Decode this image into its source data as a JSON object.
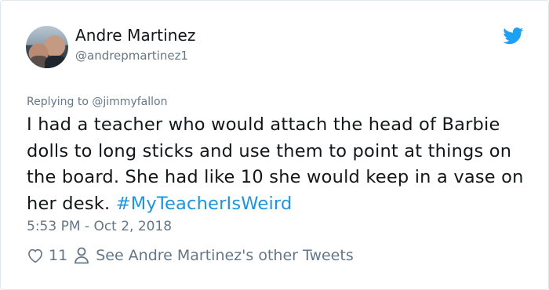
{
  "author": {
    "name": "Andre Martinez",
    "handle": "@andrepmartinez1"
  },
  "reply": {
    "prefix": "Replying to ",
    "mention": "@jimmyfallon"
  },
  "tweet": {
    "text": "I had a teacher who would attach the head of Barbie dolls to long sticks and use them to point at things on the board. She had like 10 she would keep in a vase on her desk. ",
    "hashtag": "#MyTeacherIsWeird",
    "timestamp": "5:53 PM - Oct 2, 2018"
  },
  "actions": {
    "likes": "11",
    "other_tweets": "See Andre Martinez's other Tweets"
  },
  "icons": {
    "brand": "twitter-bird-icon",
    "like": "heart-icon",
    "profile": "person-icon"
  },
  "colors": {
    "brand_blue": "#1da1f2",
    "link_blue": "#1b95e0",
    "text": "#14171a",
    "muted": "#657786"
  }
}
